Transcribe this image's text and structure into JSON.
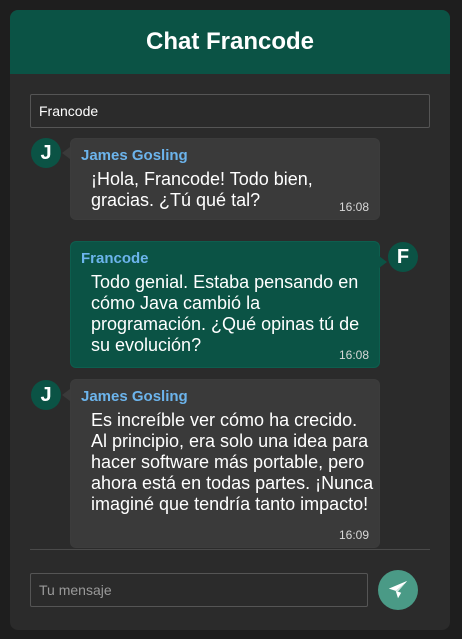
{
  "header": {
    "title": "Chat Francode"
  },
  "name_field": {
    "value": "Francode"
  },
  "messages": [
    {
      "sender": "James Gosling",
      "avatar": "J",
      "text": "¡Hola, Francode! Todo bien, gracias. ¿Tú qué tal?",
      "time": "16:08",
      "side": "left"
    },
    {
      "sender": "Francode",
      "avatar": "F",
      "text": "Todo genial. Estaba pensando en cómo Java cambió la programación. ¿Qué opinas tú de su evolución?",
      "time": "16:08",
      "side": "right"
    },
    {
      "sender": "James Gosling",
      "avatar": "J",
      "text": "Es increíble ver cómo ha crecido. Al principio, era solo una idea para hacer software más portable, pero ahora está en todas partes. ¡Nunca imaginé que tendría tanto impacto!",
      "time": "16:09",
      "side": "left"
    }
  ],
  "composer": {
    "placeholder": "Tu mensaje",
    "send_icon": "paper-plane-icon"
  },
  "colors": {
    "header": "#0b5345",
    "own_bubble": "#0b5345",
    "other_bubble": "#3a3a3a",
    "sender_name": "#6cb4ec",
    "send_button": "#4a9a86"
  }
}
